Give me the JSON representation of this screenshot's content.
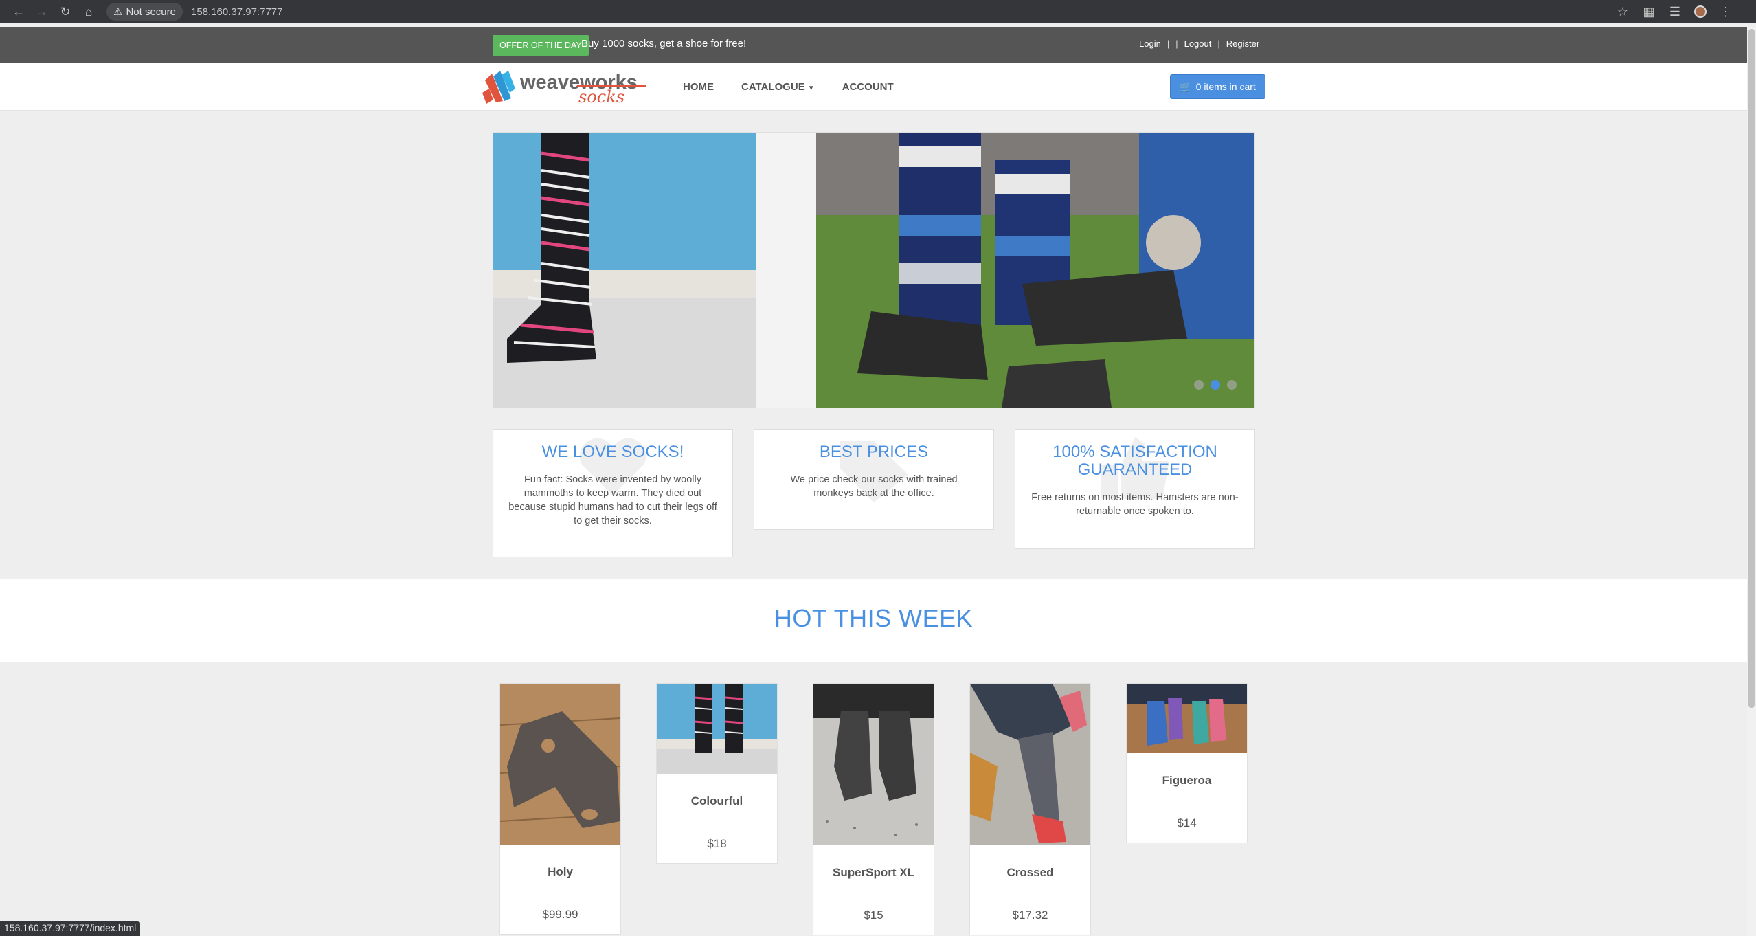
{
  "browser": {
    "security_label": "Not secure",
    "url": "158.160.37.97:7777",
    "status_url": "158.160.37.97:7777/index.html"
  },
  "topbar": {
    "offer_badge": "OFFER OF THE DAY",
    "offer_text": "Buy 1000 socks, get a shoe for free!",
    "login": "Login",
    "logout": "Logout",
    "register": "Register"
  },
  "navbar": {
    "logo_text_main": "weaveworks",
    "logo_text_sub": "socks",
    "home": "HOME",
    "catalogue": "CATALOGUE",
    "account": "ACCOUNT",
    "cart": "0 items in cart"
  },
  "carousel": {
    "active_slide": 2,
    "slide_count": 3
  },
  "features": [
    {
      "title": "WE LOVE SOCKS!",
      "text": "Fun fact: Socks were invented by woolly mammoths to keep warm. They died out because stupid humans had to cut their legs off to get their socks."
    },
    {
      "title": "BEST PRICES",
      "text": "We price check our socks with trained monkeys back at the office."
    },
    {
      "title": "100% SATISFACTION GUARANTEED",
      "text": "Free returns on most items. Hamsters are non-returnable once spoken to."
    }
  ],
  "hot": {
    "title": "HOT THIS WEEK"
  },
  "products": [
    {
      "name": "Holy",
      "price": "$99.99"
    },
    {
      "name": "Colourful",
      "price": "$18"
    },
    {
      "name": "SuperSport XL",
      "price": "$15"
    },
    {
      "name": "Crossed",
      "price": "$17.32"
    },
    {
      "name": "Figueroa",
      "price": "$14"
    }
  ],
  "colors": {
    "accent": "#4a90e2",
    "offer_green": "#5cb85c",
    "topbar_gray": "#555555",
    "cart_blue": "#4a8fe0"
  }
}
